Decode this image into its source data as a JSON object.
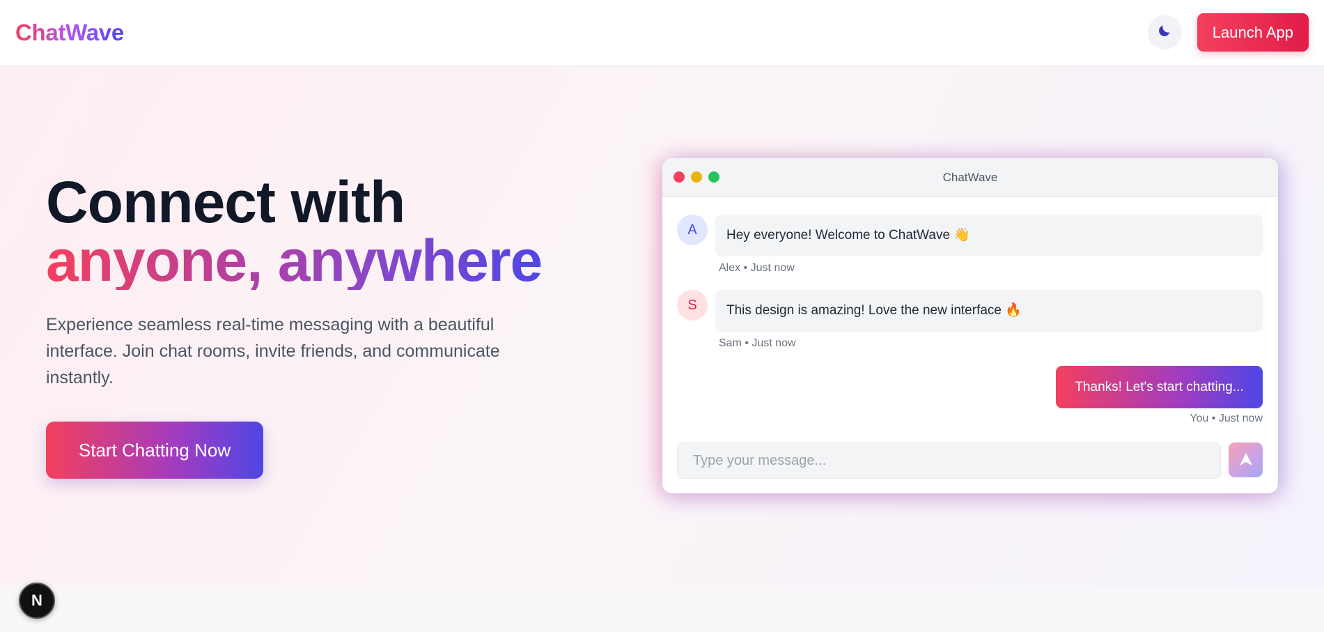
{
  "header": {
    "logo": "ChatWave",
    "theme_toggle_icon": "moon-icon",
    "launch_label": "Launch App"
  },
  "hero": {
    "title_line1": "Connect with",
    "title_line2": "anyone, anywhere",
    "description": "Experience seamless real-time messaging with a beautiful interface. Join chat rooms, invite friends, and communicate instantly.",
    "cta_label": "Start Chatting Now"
  },
  "chat": {
    "window_title": "ChatWave",
    "messages": [
      {
        "avatar": "A",
        "text": "Hey everyone! Welcome to ChatWave 👋",
        "meta": "Alex • Just now"
      },
      {
        "avatar": "S",
        "text": "This design is amazing! Love the new interface 🔥",
        "meta": "Sam • Just now"
      },
      {
        "text": "Thanks! Let's start chatting...",
        "meta": "You • Just now"
      }
    ],
    "input_placeholder": "Type your message...",
    "send_icon": "send-icon"
  },
  "badge": {
    "label": "N"
  },
  "colors": {
    "accent_pink": "#f43f5e",
    "accent_indigo": "#4f46e5",
    "accent_purple": "#a855f7"
  }
}
